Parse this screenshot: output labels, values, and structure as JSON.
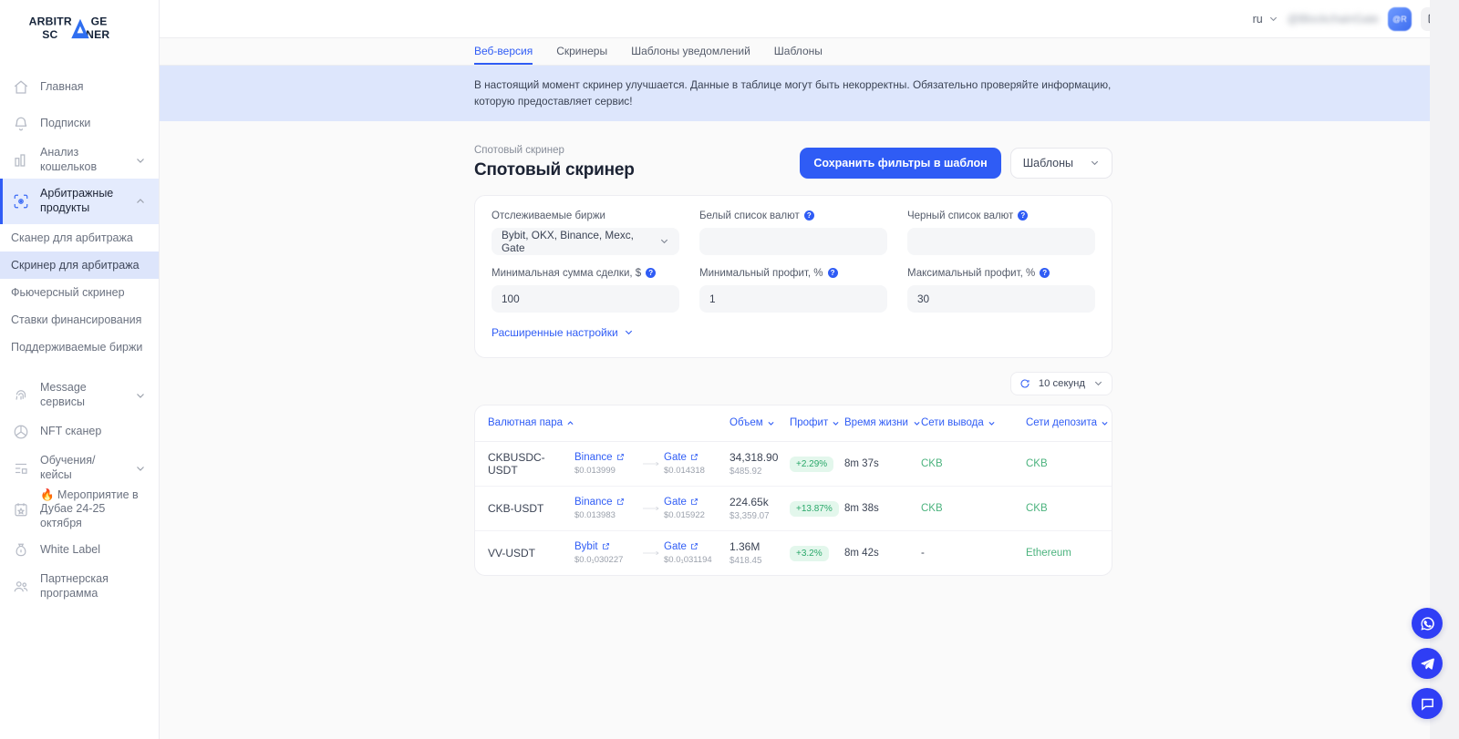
{
  "brand": {
    "name_top": "ARBITRAGE",
    "name_bottom": "SCANNER"
  },
  "sidebar": {
    "items": [
      {
        "label": "Главная",
        "icon": "home-icon",
        "expandable": false
      },
      {
        "label": "Подписки",
        "icon": "bell-icon",
        "expandable": false
      },
      {
        "label": "Анализ кошельков",
        "icon": "bar-chart-icon",
        "expandable": true
      },
      {
        "label": "Арбитражные продукты",
        "icon": "scan-eye-icon",
        "expandable": true,
        "active": true
      }
    ],
    "subitems": [
      {
        "label": "Сканер для арбитража",
        "selected": false
      },
      {
        "label": "Скринер для арбитража",
        "selected": true
      },
      {
        "label": "Фьючерсный скринер",
        "selected": false
      },
      {
        "label": "Ставки финансирования",
        "selected": false
      },
      {
        "label": "Поддерживаемые биржи",
        "selected": false
      }
    ],
    "items2": [
      {
        "label": "Message сервисы",
        "icon": "fingerprint-icon",
        "expandable": true
      },
      {
        "label": "NFT сканер",
        "icon": "aperture-icon",
        "expandable": false
      },
      {
        "label": "Обучения/кейсы",
        "icon": "layout-list-icon",
        "expandable": true
      },
      {
        "label": "🔥 Мероприятие в Дубае 24-25 октября",
        "icon": "calendar-star-icon",
        "expandable": false
      },
      {
        "label": "White Label",
        "icon": "money-bag-icon",
        "expandable": false
      },
      {
        "label": "Партнерская программа",
        "icon": "users-icon",
        "expandable": false
      }
    ]
  },
  "topbar": {
    "language": "ru",
    "username": "@BlockchainGate",
    "avatar_text": "@R",
    "logout_icon": "logout-icon"
  },
  "tabs": [
    {
      "label": "Веб-версия",
      "active": true
    },
    {
      "label": "Скринеры",
      "active": false
    },
    {
      "label": "Шаблоны уведомлений",
      "active": false
    },
    {
      "label": "Шаблоны",
      "active": false
    }
  ],
  "banner": {
    "text": "В настоящий момент скринер улучшается. Данные в таблице могут быть некорректны. Обязательно проверяйте информацию, которую предоставляет сервис!"
  },
  "page": {
    "breadcrumb": "Спотовый скринер",
    "title": "Спотовый скринер",
    "save_template_button": "Сохранить фильтры в шаблон",
    "templates_button": "Шаблоны"
  },
  "filters": {
    "exchanges": {
      "label": "Отслеживаемые биржи",
      "value": "Bybit, OKX, Binance, Mexc, Gate",
      "help": false
    },
    "whitelist": {
      "label": "Белый список валют",
      "value": "",
      "placeholder": "",
      "help": true
    },
    "blacklist": {
      "label": "Черный список валют",
      "value": "",
      "placeholder": "",
      "help": true
    },
    "min_amount": {
      "label": "Минимальная сумма сделки, $",
      "value": "100",
      "help": true
    },
    "min_profit": {
      "label": "Минимальный профит, %",
      "value": "1",
      "help": true
    },
    "max_profit": {
      "label": "Максимальный профит, %",
      "value": "30",
      "help": true
    },
    "advanced_label": "Расширенные настройки"
  },
  "refresh": {
    "label": "10 секунд",
    "icon": "refresh-icon"
  },
  "table": {
    "columns": [
      {
        "label": "Валютная пара",
        "sort": "asc"
      },
      {
        "label": "",
        "sort": "none"
      },
      {
        "label": "Объем",
        "sort": "menu"
      },
      {
        "label": "Профит",
        "sort": "menu"
      },
      {
        "label": "Время жизни",
        "sort": "menu"
      },
      {
        "label": "Сети вывода",
        "sort": "menu"
      },
      {
        "label": "Сети депозита",
        "sort": "menu"
      }
    ],
    "rows": [
      {
        "pair": "CKBUSDC-USDT",
        "from_exchange": "Binance",
        "from_price": "$0.013999",
        "to_exchange": "Gate",
        "to_price": "$0.014318",
        "volume": "34,318.90",
        "volume_usd": "$485.92",
        "profit": "+2.29%",
        "lifetime": "8m 37s",
        "withdraw_net": "CKB",
        "deposit_net": "CKB"
      },
      {
        "pair": "CKB-USDT",
        "from_exchange": "Binance",
        "from_price": "$0.013983",
        "to_exchange": "Gate",
        "to_price": "$0.015922",
        "volume": "224.65k",
        "volume_usd": "$3,359.07",
        "profit": "+13.87%",
        "lifetime": "8m 38s",
        "withdraw_net": "CKB",
        "deposit_net": "CKB"
      },
      {
        "pair": "VV-USDT",
        "from_exchange": "Bybit",
        "from_price": "$0.0₁030227",
        "to_exchange": "Gate",
        "to_price": "$0.0₁031194",
        "volume": "1.36M",
        "volume_usd": "$418.45",
        "profit": "+3.2%",
        "lifetime": "8m 42s",
        "withdraw_net": "-",
        "deposit_net": "Ethereum"
      }
    ]
  },
  "fabs": [
    {
      "name": "whatsapp-fab",
      "icon": "whatsapp-icon"
    },
    {
      "name": "telegram-fab",
      "icon": "telegram-icon"
    },
    {
      "name": "chat-fab",
      "icon": "chat-icon"
    }
  ],
  "colors": {
    "accent": "#2f5cf5",
    "banner_bg": "#dde6fc",
    "active_nav_bg": "#e4ebfd",
    "profit_green": "#2aa86a",
    "profit_bg": "#e3f7ec",
    "network_green": "#4cb37e"
  }
}
